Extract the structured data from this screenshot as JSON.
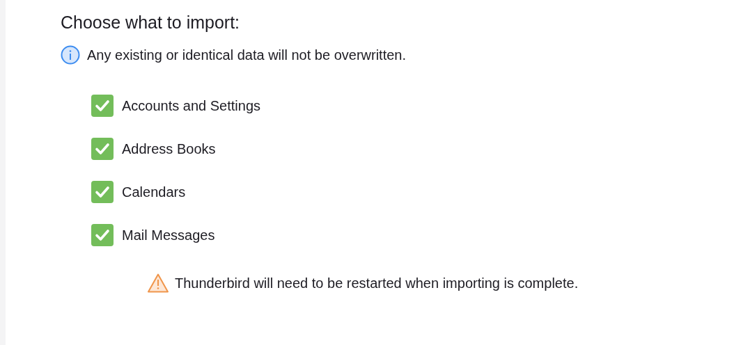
{
  "heading": "Choose what to import:",
  "info": "Any existing or identical data will not be overwritten.",
  "options": [
    {
      "label": "Accounts and Settings",
      "checked": true
    },
    {
      "label": "Address Books",
      "checked": true
    },
    {
      "label": "Calendars",
      "checked": true
    },
    {
      "label": "Mail Messages",
      "checked": true
    }
  ],
  "warning": "Thunderbird will need to be restarted when importing is complete."
}
